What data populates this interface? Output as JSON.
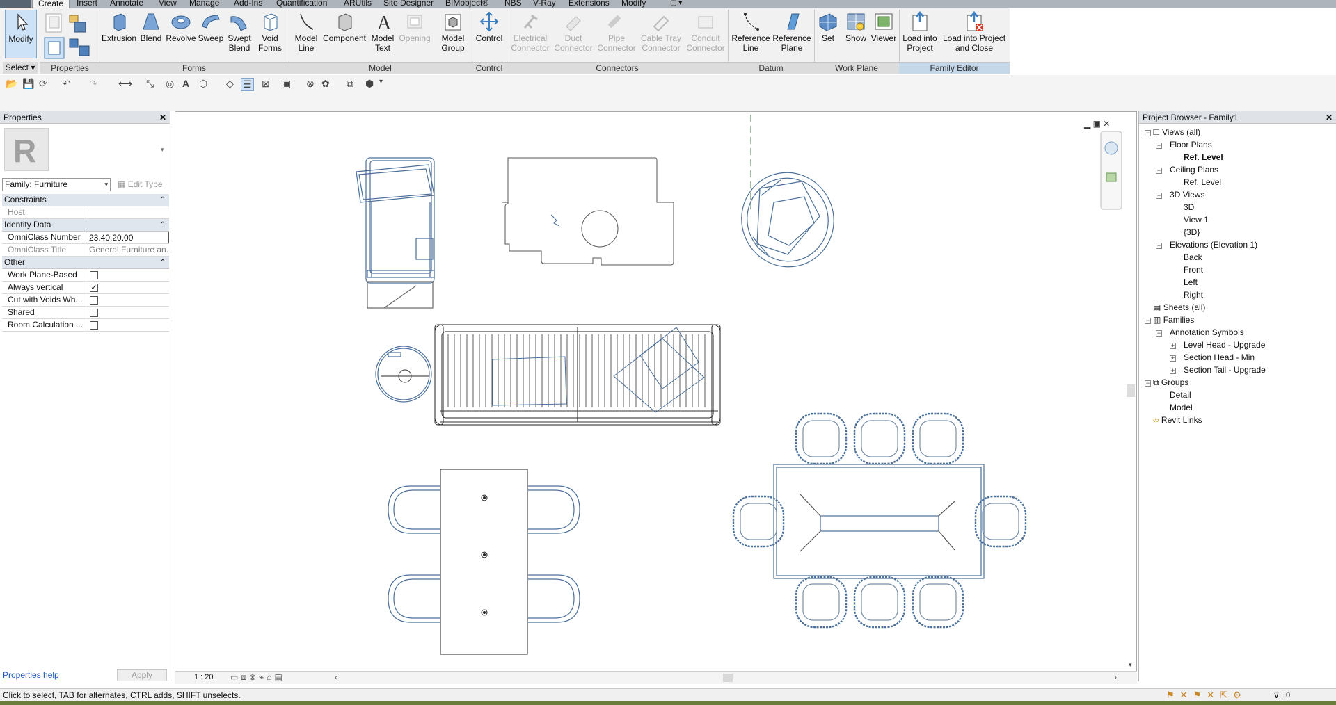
{
  "tabs": [
    "Create",
    "Insert",
    "Annotate",
    "View",
    "Manage",
    "Add-Ins",
    "Quantification",
    "ARUtils",
    "Site Designer",
    "BIMobject®",
    "NBS",
    "V-Ray",
    "Extensions",
    "Modify"
  ],
  "ribbon": {
    "modify": "Modify",
    "select_menu": "Select ▾",
    "properties_panel": "Properties",
    "forms_buttons": [
      "Extrusion",
      "Blend",
      "Revolve",
      "Sweep",
      "Swept Blend",
      "Void Forms"
    ],
    "forms_panel": "Forms",
    "model_buttons": [
      "Model Line",
      "Component",
      "Model Text",
      "Opening",
      "Model Group"
    ],
    "model_panel": "Model",
    "control_button": "Control",
    "control_panel": "Control",
    "connector_buttons": [
      "Electrical Connector",
      "Duct Connector",
      "Pipe Connector",
      "Cable Tray Connector",
      "Conduit Connector"
    ],
    "connectors_panel": "Connectors",
    "datum_buttons": [
      "Reference Line",
      "Reference Plane"
    ],
    "datum_panel": "Datum",
    "workplane_buttons": [
      "Set",
      "Show",
      "Viewer"
    ],
    "workplane_panel": "Work Plane",
    "editor_buttons": [
      "Load into Project",
      "Load into Project and Close"
    ],
    "editor_panel": "Family Editor"
  },
  "properties": {
    "title": "Properties",
    "family_select": "Family: Furniture",
    "edit_type": "Edit Type",
    "groups": {
      "constraints": "Constraints",
      "identity": "Identity Data",
      "other": "Other"
    },
    "host_label": "Host",
    "omniclass_number_label": "OmniClass Number",
    "omniclass_number_value": "23.40.20.00",
    "omniclass_title_label": "OmniClass Title",
    "omniclass_title_value": "General Furniture an...",
    "other_rows": [
      "Work Plane-Based",
      "Always vertical",
      "Cut with Voids Wh...",
      "Shared",
      "Room Calculation ..."
    ],
    "help_link": "Properties help",
    "apply": "Apply"
  },
  "browser": {
    "title": "Project Browser - Family1",
    "views_all": "Views (all)",
    "floor_plans": "Floor Plans",
    "ref_level_active": "Ref. Level",
    "ceiling_plans": "Ceiling Plans",
    "ceiling_ref_level": "Ref. Level",
    "views_3d": "3D Views",
    "v3d": "3D",
    "view1": "View 1",
    "v3d_default": "{3D}",
    "elevations": "Elevations (Elevation 1)",
    "back": "Back",
    "front": "Front",
    "left": "Left",
    "right": "Right",
    "sheets": "Sheets (all)",
    "families": "Families",
    "annotation_symbols": "Annotation Symbols",
    "level_head": "Level Head - Upgrade",
    "section_head": "Section Head - Min",
    "section_tail": "Section Tail - Upgrade",
    "groups": "Groups",
    "detail": "Detail",
    "model": "Model",
    "revit_links": "Revit Links"
  },
  "viewbar": {
    "scale": "1 : 20"
  },
  "status": "Click to select, TAB for alternates, CTRL adds, SHIFT unselects.",
  "status_filter": ":0",
  "colors": {
    "accent": "#4a6f9a",
    "ribbon": "#f1f1f1"
  }
}
